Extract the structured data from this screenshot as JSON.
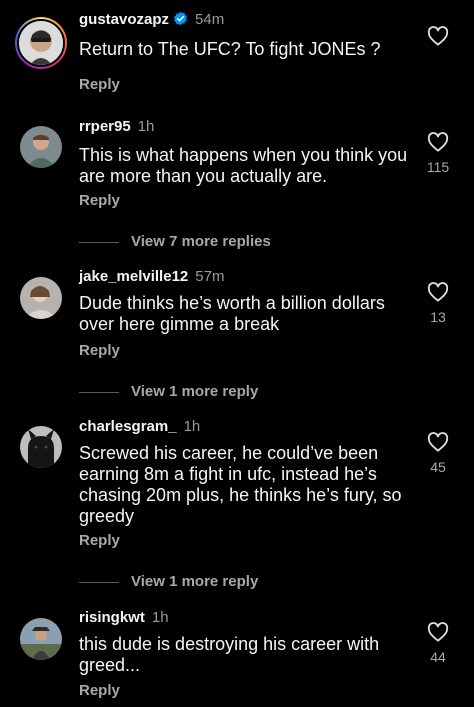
{
  "comments": [
    {
      "username": "gustavozapz",
      "verified": true,
      "time": "54m",
      "text": "Return to The UFC? To fight JONEs ?",
      "reply": "Reply",
      "likes": ""
    },
    {
      "username": "rrper95",
      "time": "1h",
      "text": "This is what happens when you think you are more than you actually are.",
      "reply": "Reply",
      "likes": "115",
      "view_more": "View 7 more replies"
    },
    {
      "username": "jake_melville12",
      "time": "57m",
      "text": "Dude thinks he’s worth a billion dollars over here gimme a break",
      "reply": "Reply",
      "likes": "13",
      "view_more": "View 1 more reply"
    },
    {
      "username": "charlesgram_",
      "time": "1h",
      "text": "Screwed his career, he could’ve been earning 8m a fight in ufc, instead he’s chasing 20m plus, he thinks he’s fury, so greedy",
      "reply": "Reply",
      "likes": "45",
      "view_more": "View 1 more reply"
    },
    {
      "username": "risingkwt",
      "time": "1h",
      "text": "this dude is destroying his career with greed...",
      "reply": "Reply",
      "likes": "44"
    }
  ],
  "colors": {
    "background": "#000000",
    "text": "#f5f5f5",
    "secondary": "#a8a8a8",
    "verified": "#0095f6"
  },
  "icons": {
    "like": "heart-icon",
    "verified": "verified-badge-icon"
  }
}
